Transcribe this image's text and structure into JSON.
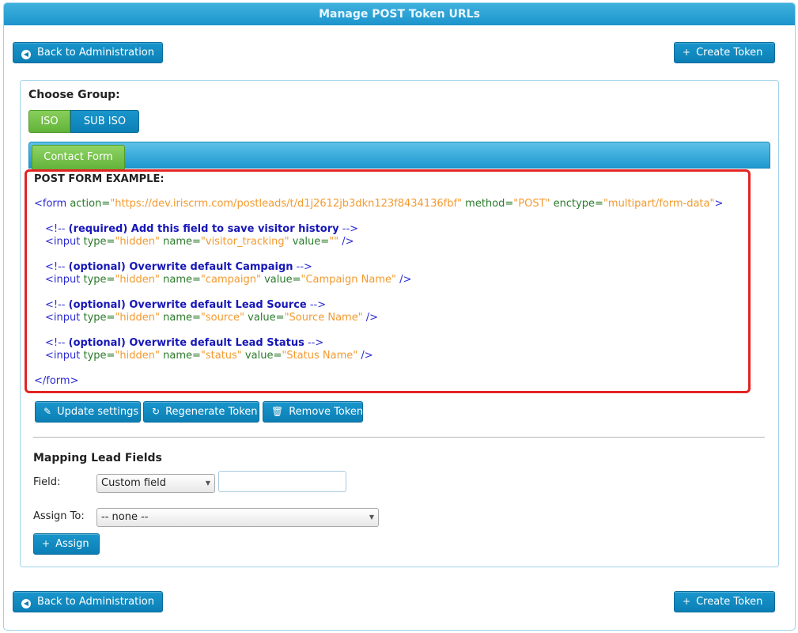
{
  "title": "Manage POST Token URLs",
  "nav": {
    "back_label": "Back to Administration",
    "create_label": "Create Token"
  },
  "group": {
    "label": "Choose Group:",
    "options": [
      "ISO",
      "SUB ISO"
    ],
    "selected": "ISO"
  },
  "tabs": [
    {
      "label": "Contact Form",
      "active": true
    }
  ],
  "post_form": {
    "heading": "POST FORM EXAMPLE:",
    "form_open": {
      "tag": "<form",
      "action_attr": " action=",
      "action_val": "\"https://dev.iriscrm.com/postleads/t/d1j2612jb3dkn123f8434136fbf\"",
      "method_attr": " method=",
      "method_val": "\"POST\"",
      "enctype_attr": " enctype=",
      "enctype_val": "\"multipart/form-data\"",
      "end": ">"
    },
    "blocks": [
      {
        "c_open": "<!-- ",
        "c_text": "(required) Add this field to save visitor history",
        "c_close": " -->",
        "input_tag": "<input",
        "type_attr": " type=",
        "type_val": "\"hidden\"",
        "name_attr": " name=",
        "name_val": "\"visitor_tracking\"",
        "value_attr": " value=",
        "value_val": "\"\"",
        "input_end": " />"
      },
      {
        "c_open": "<!-- ",
        "c_text": "(optional) Overwrite default Campaign",
        "c_close": " -->",
        "input_tag": "<input",
        "type_attr": " type=",
        "type_val": "\"hidden\"",
        "name_attr": " name=",
        "name_val": "\"campaign\"",
        "value_attr": " value=",
        "value_val": "\"Campaign Name\"",
        "input_end": " />"
      },
      {
        "c_open": "<!-- ",
        "c_text": "(optional) Overwrite default Lead Source",
        "c_close": " -->",
        "input_tag": "<input",
        "type_attr": " type=",
        "type_val": "\"hidden\"",
        "name_attr": " name=",
        "name_val": "\"source\"",
        "value_attr": " value=",
        "value_val": "\"Source Name\"",
        "input_end": " />"
      },
      {
        "c_open": "<!-- ",
        "c_text": "(optional) Overwrite default Lead Status",
        "c_close": " -->",
        "input_tag": "<input",
        "type_attr": " type=",
        "type_val": "\"hidden\"",
        "name_attr": " name=",
        "name_val": "\"status\"",
        "value_attr": " value=",
        "value_val": "\"Status Name\"",
        "input_end": " />"
      }
    ],
    "form_close": "</form>"
  },
  "actions": {
    "update_label": "Update settings",
    "regenerate_label": "Regenerate Token",
    "remove_label": "Remove Token"
  },
  "mapping": {
    "heading": "Mapping Lead Fields",
    "field_label": "Field:",
    "field_select_value": "Custom field",
    "field_input_value": "",
    "assign_to_label": "Assign To:",
    "assign_select_value": "-- none --",
    "assign_button_label": "Assign"
  },
  "icons": {
    "back": "arrow-left-circle-icon",
    "create": "plus-icon",
    "update": "pencil-icon",
    "regenerate": "refresh-icon",
    "remove": "trash-icon",
    "assign": "plus-icon",
    "dropdown": "caret-down-icon"
  },
  "colors": {
    "primary_button": "#0b7fb5",
    "active_green": "#62b33a",
    "highlight_border": "#e32424",
    "code_tag": "#2b2bd3",
    "code_attr": "#2a7a2a",
    "code_value": "#f39a2f"
  }
}
